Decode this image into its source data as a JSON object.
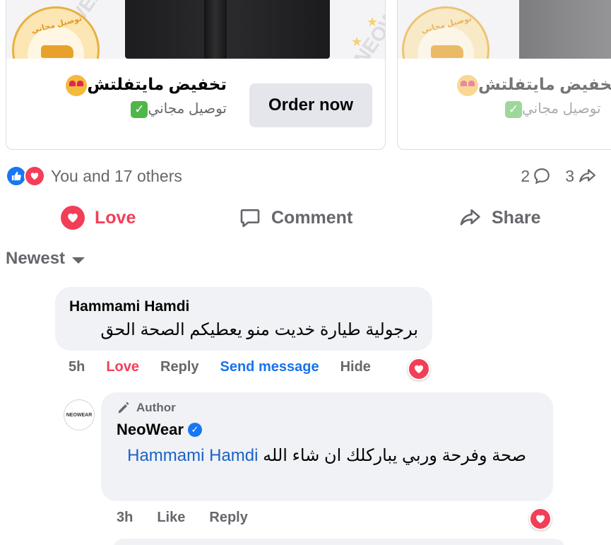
{
  "carousel": {
    "cards": [
      {
        "title": "تخفيض مايتفلتش",
        "subtitle": "توصيل مجاني",
        "button_label": "Order now",
        "watermark": "NEOWEAR"
      },
      {
        "title": "تخفيض مايتفلتش",
        "subtitle": "توصيل مجاني"
      }
    ]
  },
  "reactions": {
    "summary": "You and 17 others",
    "comment_count": "2",
    "share_count": "3"
  },
  "actions": {
    "love": "Love",
    "comment": "Comment",
    "share": "Share"
  },
  "sort": {
    "label": "Newest"
  },
  "comments": [
    {
      "author": "Hammami Hamdi",
      "text": "برجولية طيارة خديت منو يعطيكم الصحة الحق",
      "time": "5h",
      "reaction_label": "Love",
      "reply": "Reply",
      "send_message": "Send message",
      "hide": "Hide"
    }
  ],
  "reply": {
    "badge": "Author",
    "author": "NeoWear",
    "avatar_text": "NEOWEAR",
    "mention": "Hammami Hamdi",
    "text": "صحة وفرحة وربي يباركلك ان شاء الله",
    "time": "3h",
    "like": "Like",
    "reply": "Reply"
  },
  "colors": {
    "love": "#f33e58",
    "link": "#1a73e8",
    "like": "#1877f2",
    "bubble": "#f0f2f5",
    "muted": "#65676b"
  }
}
